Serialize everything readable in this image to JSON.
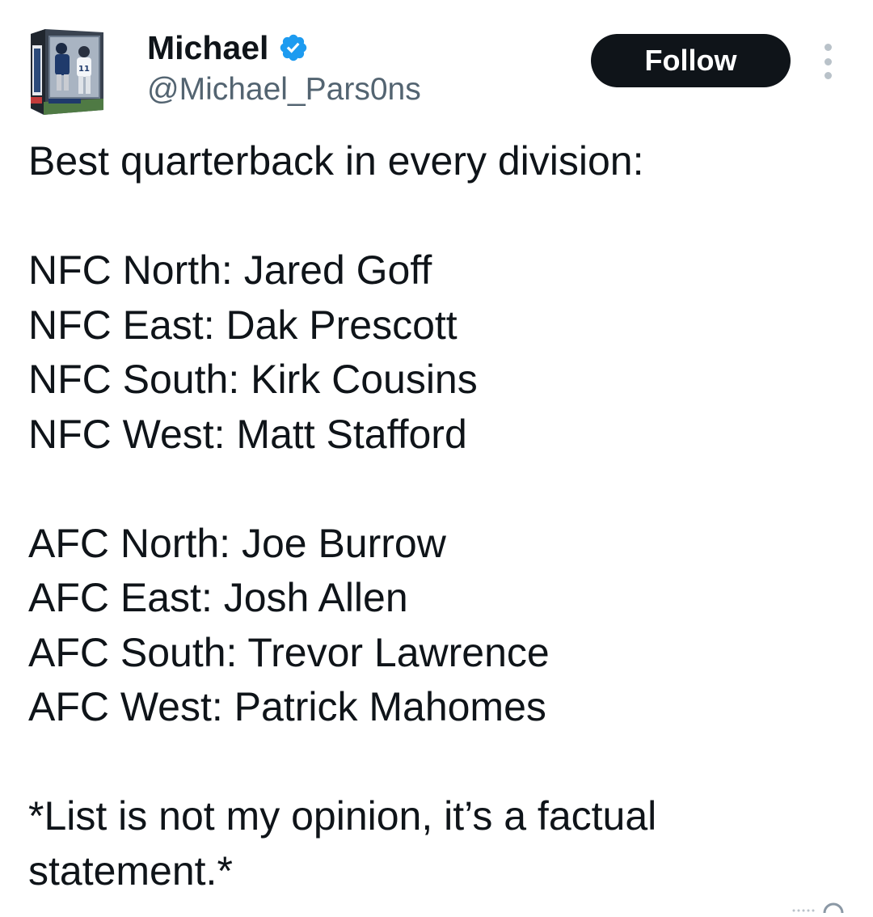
{
  "user": {
    "display_name": "Michael",
    "handle": "@Michael_Pars0ns",
    "verified": true,
    "verified_color": "#1d9bf0"
  },
  "actions": {
    "follow_label": "Follow",
    "more_icon": "more-vertical-icon"
  },
  "tweet": {
    "intro": "Best quarterback in every division:",
    "nfc": [
      "NFC North: Jared Goff",
      "NFC East: Dak Prescott",
      "NFC South: Kirk Cousins",
      "NFC West: Matt Stafford"
    ],
    "afc": [
      "AFC North: Joe Burrow",
      "AFC East: Josh Allen",
      "AFC South: Trevor Lawrence",
      "AFC West: Patrick Mahomes"
    ],
    "disclaimer_line1": "*List is not my opinion, it’s a factual",
    "disclaimer_line2": "statement.*"
  },
  "colors": {
    "text": "#0f1419",
    "secondary_text": "#536471",
    "follow_bg": "#0f1419",
    "follow_text": "#ffffff"
  }
}
